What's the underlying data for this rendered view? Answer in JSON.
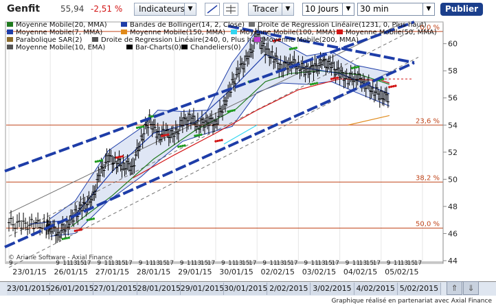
{
  "toolbar": {
    "title": "Genfit",
    "price": "55,94",
    "change": "-2,51 %",
    "indicators_label": "Indicateurs",
    "draw_label": "Tracer",
    "period": "10 Jours",
    "interval": "30 min",
    "publish_label": "Publier"
  },
  "legend": [
    {
      "label": "Moyenne Mobile(20, MMA)",
      "color": "#1f7a1f"
    },
    {
      "label": "Bandes de Bollinger(14, 2, Close)",
      "color": "#1e3da8"
    },
    {
      "label": "Droite de Regression Linéaire(1231, 0, Plus haut)",
      "color": "#707070"
    },
    {
      "label": "Moyenne Mobile(7, MMA)",
      "color": "#1e3da8"
    },
    {
      "label": "Moyenne Mobile(150, MMA)",
      "color": "#e08a1a"
    },
    {
      "label": "Moyenne Mobile(100, MMA)",
      "color": "#33d6f0"
    },
    {
      "label": "Moyenne Mobile(50, MMA)",
      "color": "#d21414"
    },
    {
      "label": "Parabolique SAR(2)",
      "color": "#8a6a2a"
    },
    {
      "label": "Droite de Regression Linéaire(240, 0, Plus haut)",
      "color": "#555555"
    },
    {
      "label": "Moyenne Mobile(200, MMA)",
      "color": "#c23ad0"
    },
    {
      "label": "Moyenne Mobile(10, EMA)",
      "color": "#555555"
    },
    {
      "label": "Bar-Charts(0)",
      "color": "#000000"
    },
    {
      "label": "Chandeliers(0)",
      "color": "#000000"
    }
  ],
  "copyright": "© Ariane Software - Axial Finance",
  "footer": "Graphique réalisé en partenariat avec Axial Finance",
  "chart_data": {
    "type": "line",
    "instrument": "Genfit",
    "ylim": [
      44,
      61.5
    ],
    "yticks": [
      44,
      46,
      48,
      50,
      52,
      54,
      56,
      58,
      60
    ],
    "hours": [
      "9",
      "11",
      "13",
      "15",
      "17"
    ],
    "days_top": [
      "23/01/15",
      "26/01/15",
      "27/01/15",
      "28/01/15",
      "29/01/15",
      "30/01/15",
      "02/02/15",
      "03/02/15",
      "04/02/15",
      "05/02/15"
    ],
    "days_bottom": [
      "23/01/2015",
      "26/01/2015",
      "27/01/2015",
      "28/01/2015",
      "29/01/2015",
      "30/01/2015",
      "2/02/2015",
      "3/02/2015",
      "4/02/2015",
      "5/02/2015"
    ],
    "fibonacci": [
      {
        "label": "0,0 %",
        "value": 60.9
      },
      {
        "label": "23,6 %",
        "value": 54.0
      },
      {
        "label": "38,2 %",
        "value": 49.8
      },
      {
        "label": "50,0 %",
        "value": 46.4
      }
    ],
    "last_price_value": 57.4,
    "price_series": [
      {
        "t": 0,
        "v": 46.8
      },
      {
        "t": 0.3,
        "v": 46.6
      },
      {
        "t": 0.6,
        "v": 46.7
      },
      {
        "t": 0.9,
        "v": 46.6
      },
      {
        "t": 1.0,
        "v": 46.5
      },
      {
        "t": 1.2,
        "v": 46.0
      },
      {
        "t": 1.4,
        "v": 46.6
      },
      {
        "t": 1.6,
        "v": 47.4
      },
      {
        "t": 1.8,
        "v": 48.0
      },
      {
        "t": 2.0,
        "v": 48.4
      },
      {
        "t": 2.2,
        "v": 50.4
      },
      {
        "t": 2.4,
        "v": 51.6
      },
      {
        "t": 2.6,
        "v": 51.2
      },
      {
        "t": 2.8,
        "v": 51.0
      },
      {
        "t": 3.0,
        "v": 51.0
      },
      {
        "t": 3.2,
        "v": 53.0
      },
      {
        "t": 3.4,
        "v": 54.4
      },
      {
        "t": 3.6,
        "v": 53.2
      },
      {
        "t": 3.8,
        "v": 53.4
      },
      {
        "t": 4.0,
        "v": 53.2
      },
      {
        "t": 4.2,
        "v": 54.2
      },
      {
        "t": 4.4,
        "v": 54.5
      },
      {
        "t": 4.6,
        "v": 54.0
      },
      {
        "t": 4.8,
        "v": 54.3
      },
      {
        "t": 5.0,
        "v": 54.2
      },
      {
        "t": 5.2,
        "v": 55.5
      },
      {
        "t": 5.4,
        "v": 57.0
      },
      {
        "t": 5.6,
        "v": 58.2
      },
      {
        "t": 5.8,
        "v": 59.0
      },
      {
        "t": 6.0,
        "v": 60.5
      },
      {
        "t": 6.2,
        "v": 59.5
      },
      {
        "t": 6.4,
        "v": 59.0
      },
      {
        "t": 6.6,
        "v": 58.2
      },
      {
        "t": 6.8,
        "v": 58.6
      },
      {
        "t": 7.0,
        "v": 58.4
      },
      {
        "t": 7.2,
        "v": 58.0
      },
      {
        "t": 7.4,
        "v": 58.2
      },
      {
        "t": 7.6,
        "v": 58.6
      },
      {
        "t": 7.8,
        "v": 58.3
      },
      {
        "t": 8.0,
        "v": 57.8
      },
      {
        "t": 8.2,
        "v": 57.4
      },
      {
        "t": 8.4,
        "v": 57.6
      },
      {
        "t": 8.6,
        "v": 57.1
      },
      {
        "t": 8.8,
        "v": 56.6
      },
      {
        "t": 9.0,
        "v": 56.2
      },
      {
        "t": 9.2,
        "v": 56.0
      }
    ],
    "series": [
      {
        "name": "Moyenne Mobile(20, MMA)",
        "color": "#1f7a1f",
        "points": [
          [
            1.5,
            46.5
          ],
          [
            2.5,
            48.8
          ],
          [
            3.5,
            51.5
          ],
          [
            4.5,
            53.6
          ],
          [
            5.5,
            55.2
          ],
          [
            6.2,
            57.2
          ],
          [
            6.8,
            57.8
          ],
          [
            7.5,
            58.0
          ],
          [
            8.5,
            57.7
          ],
          [
            9.2,
            57.0
          ]
        ]
      },
      {
        "name": "Moyenne Mobile(50, MMA)",
        "color": "#d21414",
        "points": [
          [
            3.0,
            50.1
          ],
          [
            4.0,
            51.8
          ],
          [
            5.0,
            53.4
          ],
          [
            6.0,
            55.1
          ],
          [
            7.0,
            56.6
          ],
          [
            8.0,
            57.4
          ],
          [
            9.0,
            57.3
          ],
          [
            9.2,
            57.1
          ]
        ]
      },
      {
        "name": "Moyenne Mobile(100, MMA)",
        "color": "#33d6f0",
        "points": [
          [
            5.2,
            52.6
          ],
          [
            6.0,
            54.0
          ]
        ]
      },
      {
        "name": "Moyenne Mobile(150, MMA)",
        "color": "#e08a1a",
        "points": [
          [
            8.2,
            54.0
          ],
          [
            9.2,
            54.7
          ]
        ]
      },
      {
        "name": "Moyenne Mobile(7, MMA)",
        "color": "#1e3da8",
        "points": [
          [
            0.5,
            46.7
          ],
          [
            1.5,
            47.0
          ],
          [
            2.5,
            50.6
          ],
          [
            3.5,
            53.4
          ],
          [
            4.5,
            54.2
          ],
          [
            5.5,
            57.0
          ],
          [
            6.2,
            59.2
          ],
          [
            7.0,
            58.3
          ],
          [
            8.0,
            57.8
          ],
          [
            9.2,
            56.3
          ]
        ]
      },
      {
        "name": "Droite de Regression Linéaire(1231, 0, Plus haut)",
        "color": "#707070",
        "points": [
          [
            0,
            47.5
          ],
          [
            9.5,
            61.5
          ]
        ]
      }
    ],
    "bollinger": {
      "upper": [
        [
          1.0,
          47.1
        ],
        [
          1.6,
          48.4
        ],
        [
          2.4,
          52.1
        ],
        [
          3.2,
          53.8
        ],
        [
          3.6,
          55.1
        ],
        [
          4.2,
          55.0
        ],
        [
          4.8,
          55.1
        ],
        [
          5.4,
          58.6
        ],
        [
          6.0,
          61.0
        ],
        [
          6.6,
          60.1
        ],
        [
          7.2,
          59.1
        ],
        [
          7.8,
          59.4
        ],
        [
          8.4,
          58.4
        ],
        [
          9.2,
          57.9
        ]
      ],
      "lower": [
        [
          1.0,
          45.8
        ],
        [
          1.6,
          46.0
        ],
        [
          2.4,
          48.4
        ],
        [
          3.2,
          50.2
        ],
        [
          3.6,
          51.3
        ],
        [
          4.2,
          52.8
        ],
        [
          4.8,
          53.4
        ],
        [
          5.4,
          53.9
        ],
        [
          6.0,
          56.4
        ],
        [
          6.6,
          57.1
        ],
        [
          7.2,
          57.0
        ],
        [
          7.8,
          57.2
        ],
        [
          8.4,
          56.4
        ],
        [
          9.2,
          55.4
        ]
      ]
    },
    "regression_channel": {
      "color": "#1e3da8",
      "upper": [
        [
          0,
          50.6
        ],
        [
          9.8,
          58.6
        ]
      ],
      "lower": [
        [
          0,
          44.8
        ],
        [
          9.8,
          58.6
        ]
      ],
      "upper_end": [
        [
          0,
          50.6
        ],
        [
          9.8,
          58.6
        ]
      ]
    },
    "sar_points": [
      [
        1.3,
        45.6
      ],
      [
        1.6,
        46.2
      ],
      [
        1.9,
        47.0
      ],
      [
        2.1,
        51.3
      ],
      [
        2.6,
        51.6
      ],
      [
        3.1,
        53.8
      ],
      [
        3.4,
        54.6
      ],
      [
        3.7,
        53.2
      ],
      [
        4.1,
        52.4
      ],
      [
        4.5,
        53.2
      ],
      [
        5.0,
        52.8
      ],
      [
        5.3,
        55.0
      ],
      [
        5.8,
        57.2
      ],
      [
        6.4,
        60.2
      ],
      [
        6.8,
        59.6
      ],
      [
        7.3,
        57.0
      ],
      [
        7.8,
        57.4
      ],
      [
        8.3,
        58.2
      ],
      [
        8.9,
        57.3
      ],
      [
        9.2,
        56.8
      ]
    ]
  }
}
